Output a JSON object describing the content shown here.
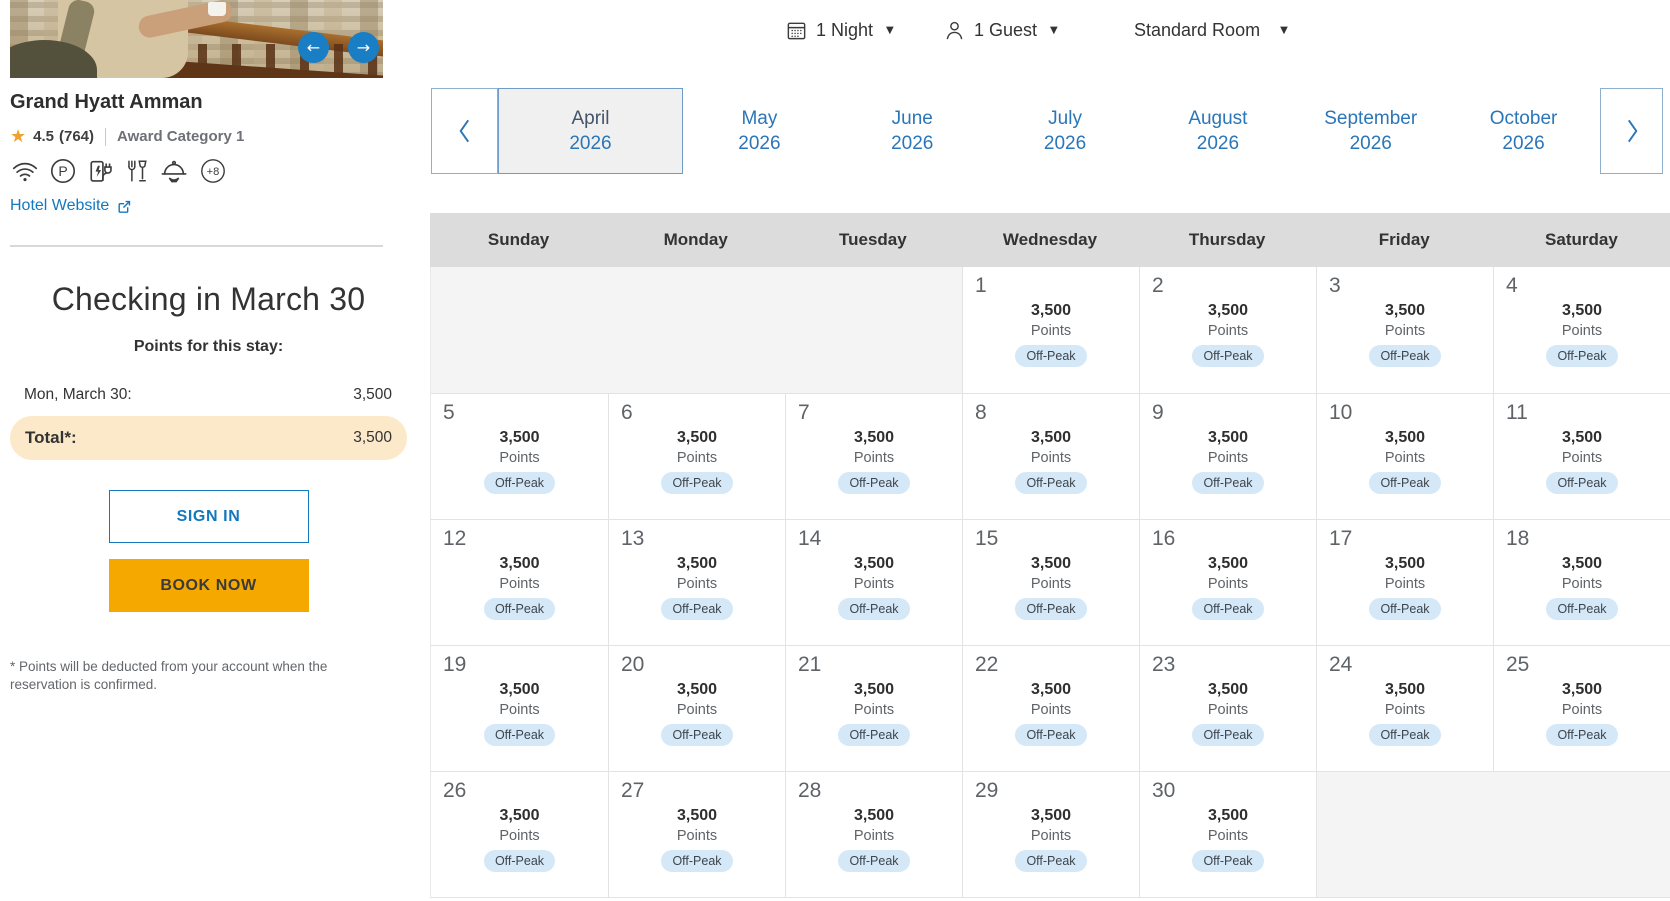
{
  "sidebar": {
    "hotel": {
      "name": "Grand Hyatt Amman",
      "rating": "4.5",
      "reviews": "(764)",
      "award": "Award Category 1",
      "amenities": [
        "wifi",
        "parking",
        "ev-charging",
        "dining",
        "room-service"
      ],
      "amenities_more": "+8",
      "website_label": "Hotel Website"
    },
    "checkin": {
      "title": "Checking in March 30",
      "subtitle": "Points for this stay:",
      "rows": [
        {
          "label": "Mon, March 30:",
          "value": "3,500"
        }
      ],
      "total_label": "Total*:",
      "total_value": "3,500"
    },
    "signin_label": "SIGN IN",
    "book_label": "BOOK NOW",
    "footnote": "* Points will be deducted from your account when the reservation is confirmed."
  },
  "topbar": {
    "nights_label": "1 Night",
    "guests_label": "1 Guest",
    "room_label": "Standard Room"
  },
  "months": {
    "selected": {
      "name": "April",
      "year": "2026"
    },
    "upcoming": [
      {
        "name": "May",
        "year": "2026"
      },
      {
        "name": "June",
        "year": "2026"
      },
      {
        "name": "July",
        "year": "2026"
      },
      {
        "name": "August",
        "year": "2026"
      },
      {
        "name": "September",
        "year": "2026"
      },
      {
        "name": "October",
        "year": "2026"
      }
    ]
  },
  "calendar": {
    "weekdays": [
      "Sunday",
      "Monday",
      "Tuesday",
      "Wednesday",
      "Thursday",
      "Friday",
      "Saturday"
    ],
    "leading_empty": 3,
    "trailing_empty": 2,
    "days": [
      {
        "day": "1",
        "points": "3,500",
        "unit": "Points",
        "badge": "Off-Peak"
      },
      {
        "day": "2",
        "points": "3,500",
        "unit": "Points",
        "badge": "Off-Peak"
      },
      {
        "day": "3",
        "points": "3,500",
        "unit": "Points",
        "badge": "Off-Peak"
      },
      {
        "day": "4",
        "points": "3,500",
        "unit": "Points",
        "badge": "Off-Peak"
      },
      {
        "day": "5",
        "points": "3,500",
        "unit": "Points",
        "badge": "Off-Peak"
      },
      {
        "day": "6",
        "points": "3,500",
        "unit": "Points",
        "badge": "Off-Peak"
      },
      {
        "day": "7",
        "points": "3,500",
        "unit": "Points",
        "badge": "Off-Peak"
      },
      {
        "day": "8",
        "points": "3,500",
        "unit": "Points",
        "badge": "Off-Peak"
      },
      {
        "day": "9",
        "points": "3,500",
        "unit": "Points",
        "badge": "Off-Peak"
      },
      {
        "day": "10",
        "points": "3,500",
        "unit": "Points",
        "badge": "Off-Peak"
      },
      {
        "day": "11",
        "points": "3,500",
        "unit": "Points",
        "badge": "Off-Peak"
      },
      {
        "day": "12",
        "points": "3,500",
        "unit": "Points",
        "badge": "Off-Peak"
      },
      {
        "day": "13",
        "points": "3,500",
        "unit": "Points",
        "badge": "Off-Peak"
      },
      {
        "day": "14",
        "points": "3,500",
        "unit": "Points",
        "badge": "Off-Peak"
      },
      {
        "day": "15",
        "points": "3,500",
        "unit": "Points",
        "badge": "Off-Peak"
      },
      {
        "day": "16",
        "points": "3,500",
        "unit": "Points",
        "badge": "Off-Peak"
      },
      {
        "day": "17",
        "points": "3,500",
        "unit": "Points",
        "badge": "Off-Peak"
      },
      {
        "day": "18",
        "points": "3,500",
        "unit": "Points",
        "badge": "Off-Peak"
      },
      {
        "day": "19",
        "points": "3,500",
        "unit": "Points",
        "badge": "Off-Peak"
      },
      {
        "day": "20",
        "points": "3,500",
        "unit": "Points",
        "badge": "Off-Peak"
      },
      {
        "day": "21",
        "points": "3,500",
        "unit": "Points",
        "badge": "Off-Peak"
      },
      {
        "day": "22",
        "points": "3,500",
        "unit": "Points",
        "badge": "Off-Peak"
      },
      {
        "day": "23",
        "points": "3,500",
        "unit": "Points",
        "badge": "Off-Peak"
      },
      {
        "day": "24",
        "points": "3,500",
        "unit": "Points",
        "badge": "Off-Peak"
      },
      {
        "day": "25",
        "points": "3,500",
        "unit": "Points",
        "badge": "Off-Peak"
      },
      {
        "day": "26",
        "points": "3,500",
        "unit": "Points",
        "badge": "Off-Peak"
      },
      {
        "day": "27",
        "points": "3,500",
        "unit": "Points",
        "badge": "Off-Peak"
      },
      {
        "day": "28",
        "points": "3,500",
        "unit": "Points",
        "badge": "Off-Peak"
      },
      {
        "day": "29",
        "points": "3,500",
        "unit": "Points",
        "badge": "Off-Peak"
      },
      {
        "day": "30",
        "points": "3,500",
        "unit": "Points",
        "badge": "Off-Peak"
      }
    ]
  },
  "colors": {
    "accent_blue": "#1478be",
    "month_blue": "#2a76b8",
    "selected_month_text": "#44546a",
    "book_now_bg": "#f5a800",
    "total_row_bg": "#fbe9c9",
    "badge_bg": "#d4e8f8",
    "weekday_header_bg": "#dcdcdc",
    "empty_cell_bg": "#f4f4f4",
    "star": "#efa32f"
  }
}
